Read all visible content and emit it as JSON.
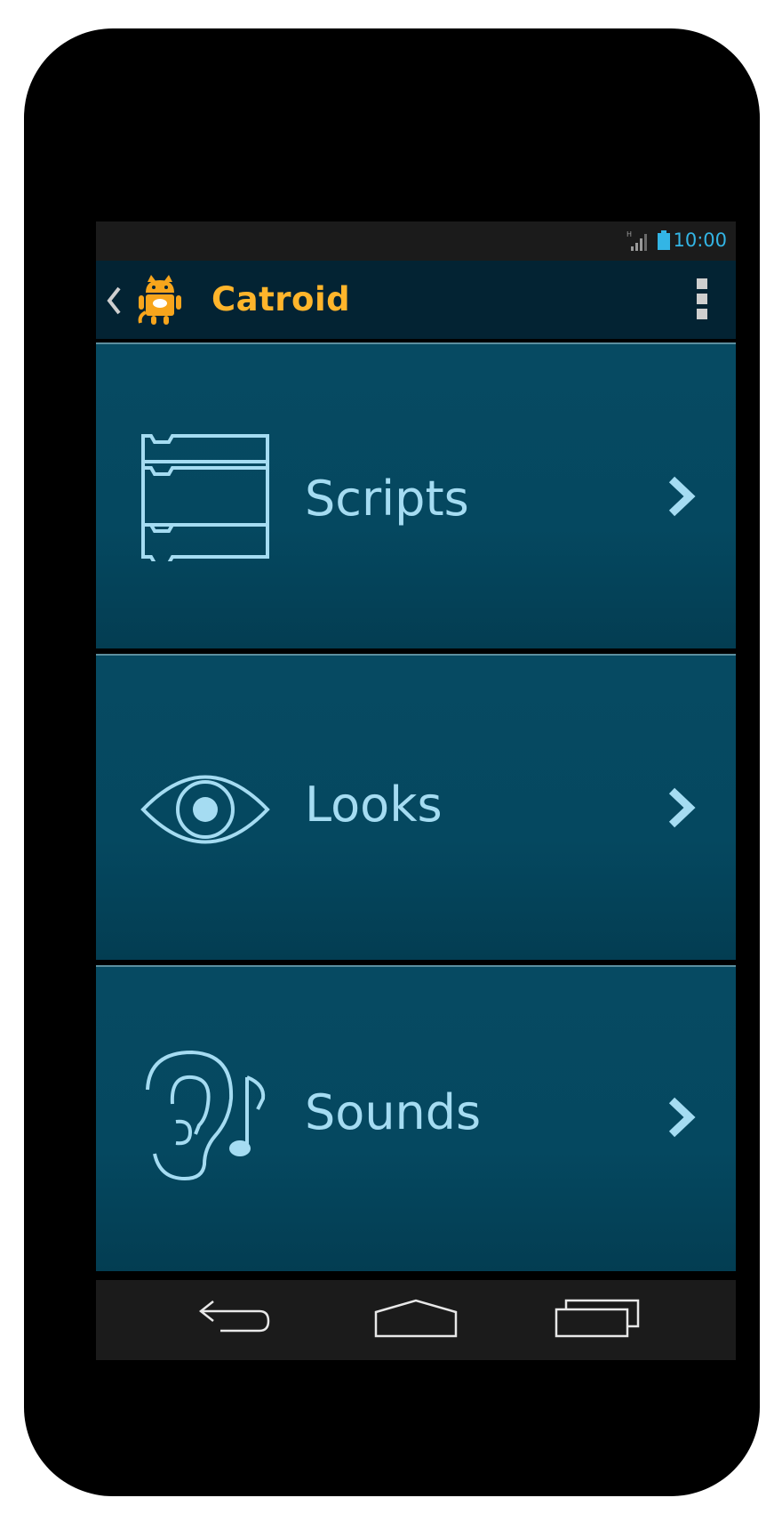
{
  "status_bar": {
    "time": "10:00",
    "network_label": "H",
    "signal_icon": "signal-icon",
    "battery_icon": "battery-icon",
    "accent_color": "#33b5e5"
  },
  "action_bar": {
    "title": "Catroid",
    "title_color": "#ffb52b",
    "back_icon": "chevron-left-icon",
    "logo_icon": "catroid-logo-icon",
    "menu_icon": "overflow-menu-icon"
  },
  "tiles": [
    {
      "label": "Scripts",
      "icon": "scripts-icon"
    },
    {
      "label": "Looks",
      "icon": "eye-icon"
    },
    {
      "label": "Sounds",
      "icon": "ear-music-icon"
    }
  ],
  "nav_bar": {
    "back_icon": "back-icon",
    "home_icon": "home-icon",
    "recents_icon": "recent-apps-icon"
  },
  "colors": {
    "tile_bg": "#054860",
    "tile_text": "#a5dcf2"
  }
}
